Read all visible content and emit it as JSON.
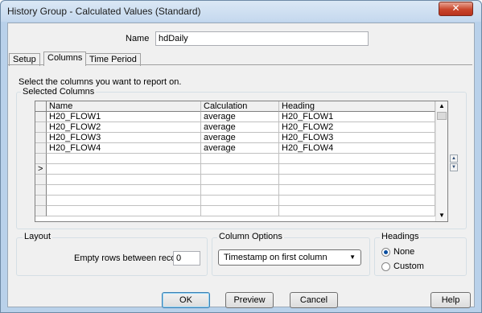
{
  "window": {
    "title": "History Group - Calculated Values (Standard)"
  },
  "name": {
    "label": "Name",
    "value": "hdDaily"
  },
  "tabs": [
    {
      "label": "Setup"
    },
    {
      "label": "Columns"
    },
    {
      "label": "Time Period"
    }
  ],
  "instructions": "Select the columns you want to report on.",
  "selected_columns": {
    "group_label": "Selected Columns",
    "headers": [
      "Name",
      "Calculation",
      "Heading"
    ],
    "rows": [
      {
        "name": "H20_FLOW1",
        "calculation": "average",
        "heading": "H20_FLOW1"
      },
      {
        "name": "H20_FLOW2",
        "calculation": "average",
        "heading": "H20_FLOW2"
      },
      {
        "name": "H20_FLOW3",
        "calculation": "average",
        "heading": "H20_FLOW3"
      },
      {
        "name": "H20_FLOW4",
        "calculation": "average",
        "heading": "H20_FLOW4"
      }
    ],
    "current_row_marker": ">"
  },
  "layout": {
    "group_label": "Layout",
    "empty_rows_label": "Empty rows between records",
    "empty_rows_value": "0"
  },
  "column_options": {
    "group_label": "Column Options",
    "selected": "Timestamp on first column"
  },
  "headings": {
    "group_label": "Headings",
    "options": [
      "None",
      "Custom"
    ],
    "selected": "None"
  },
  "buttons": {
    "ok": "OK",
    "preview": "Preview",
    "cancel": "Cancel",
    "help": "Help"
  },
  "icons": {
    "close": "close-icon",
    "dropdown": "chevron-down-icon",
    "scroll_up": "scroll-up-icon",
    "scroll_down": "scroll-down-icon"
  },
  "colors": {
    "window_frame": "#b9d1ea",
    "close_button": "#c9452b",
    "selected_radio": "#0a4ea0"
  }
}
